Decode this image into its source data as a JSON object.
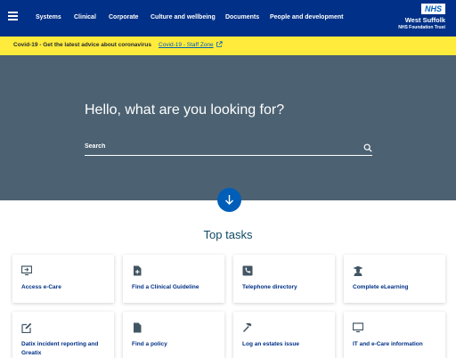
{
  "nav": {
    "links": [
      "Systems",
      "Clinical",
      "Corporate",
      "Culture and wellbeing",
      "Documents",
      "People and development"
    ],
    "logo": "NHS",
    "org_name": "West Suffolk",
    "org_sub": "NHS Foundation Trust"
  },
  "alert": {
    "text": "Covid-19 - Get the latest advice about coronavirus",
    "link": "Covid-19 - Staff Zone"
  },
  "hero": {
    "title": "Hello, what are you looking for?",
    "search_placeholder": "Search"
  },
  "top_tasks": {
    "title": "Top tasks",
    "cards": [
      {
        "label": "Access e-Care",
        "icon": "monitor-arrow-icon"
      },
      {
        "label": "Find a Clinical Guideline",
        "icon": "document-plus-icon"
      },
      {
        "label": "Telephone directory",
        "icon": "phone-icon"
      },
      {
        "label": "Complete eLearning",
        "icon": "graduate-icon"
      },
      {
        "label": "Datix incident reporting and Greatix",
        "icon": "edit-icon"
      },
      {
        "label": "Find a policy",
        "icon": "document-icon"
      },
      {
        "label": "Log an estates issue",
        "icon": "hammer-icon"
      },
      {
        "label": "IT and e-Care information",
        "icon": "monitor-icon"
      }
    ]
  },
  "colors": {
    "nav_bg": "#003087",
    "alert_bg": "#ffeb3b",
    "hero_bg": "#4c6272",
    "accent": "#005eb8",
    "card_label": "#003087",
    "icon": "#425563"
  }
}
